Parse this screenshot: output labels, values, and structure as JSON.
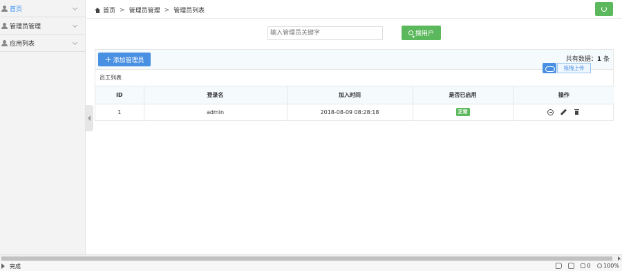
{
  "sidebar": {
    "items": [
      {
        "label": "首页"
      },
      {
        "label": "管理员管理"
      },
      {
        "label": "应用列表"
      }
    ]
  },
  "breadcrumb": {
    "home": "首页",
    "sep": ">",
    "level2": "管理员管理",
    "level3": "管理员列表"
  },
  "search": {
    "placeholder": "输入管理员关键字",
    "button_label": "搜用户"
  },
  "panel": {
    "add_label": "添加管理员",
    "total_prefix": "共有数据：",
    "total_count": "1",
    "total_suffix": " 条",
    "upload_label": "拖拽上传",
    "section_title": "员工列表"
  },
  "table": {
    "headers": [
      "ID",
      "登录名",
      "加入时间",
      "是否已启用",
      "操作"
    ],
    "rows": [
      {
        "id": "1",
        "login": "admin",
        "joined": "2018-08-09 08:28:18",
        "status": "正常"
      }
    ]
  },
  "statusbar": {
    "text": "完成",
    "zoom": "100%",
    "count": "0"
  },
  "colors": {
    "green": "#5cb85c",
    "blue": "#4a90e2",
    "active_link": "#2d8cf0"
  }
}
